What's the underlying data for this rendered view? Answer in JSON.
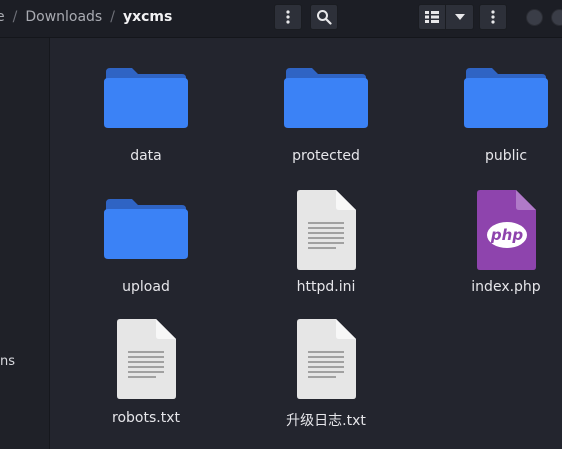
{
  "breadcrumb": {
    "clipped_tail": "e",
    "separator": "/",
    "parent": "Downloads",
    "current": "yxcms"
  },
  "toolbar": {
    "path_menu_icon": "vertical-ellipsis-icon",
    "search_icon": "search-icon",
    "view_icon": "list-view-icon",
    "view_dropdown_icon": "chevron-down-icon",
    "main_menu_icon": "vertical-ellipsis-icon"
  },
  "sidebar": {
    "clipped_label": "ns"
  },
  "files": [
    {
      "name": "data",
      "type": "folder"
    },
    {
      "name": "protected",
      "type": "folder"
    },
    {
      "name": "public",
      "type": "folder"
    },
    {
      "name": "upload",
      "type": "folder"
    },
    {
      "name": "httpd.ini",
      "type": "text"
    },
    {
      "name": "index.php",
      "type": "php"
    },
    {
      "name": "robots.txt",
      "type": "text"
    },
    {
      "name": "升级日志.txt",
      "type": "text"
    }
  ],
  "php_badge": "php",
  "colors": {
    "folder": "#3b82f6",
    "folder_tab": "#2f64c4",
    "php": "#8e44ad",
    "document": "#e8e8e8",
    "background": "#23252e"
  }
}
